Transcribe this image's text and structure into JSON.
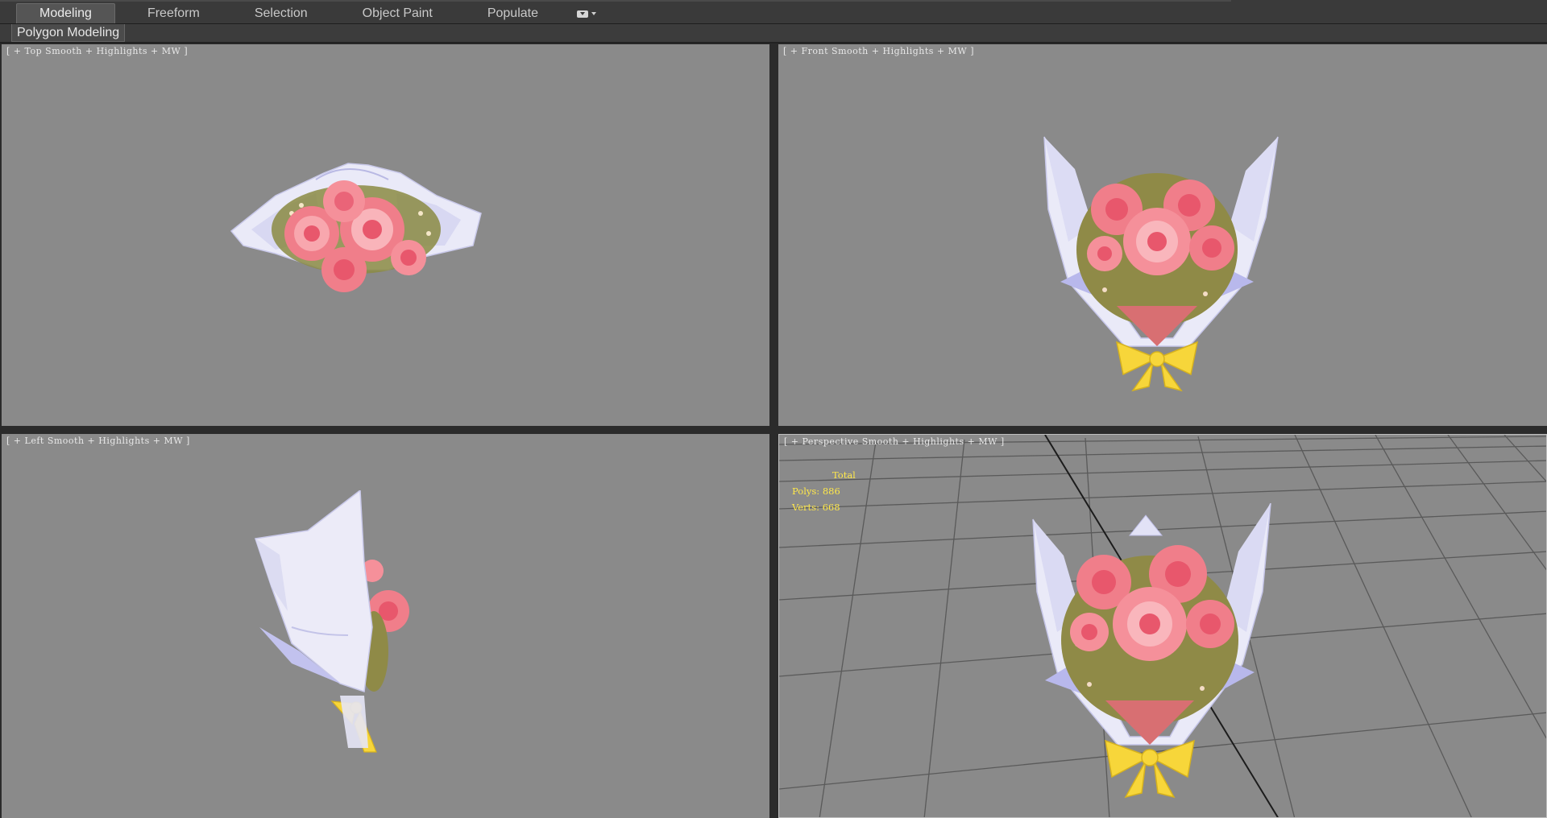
{
  "ribbon": {
    "tabs": [
      {
        "label": "Modeling",
        "active": true
      },
      {
        "label": "Freeform",
        "active": false
      },
      {
        "label": "Selection",
        "active": false
      },
      {
        "label": "Object Paint",
        "active": false
      },
      {
        "label": "Populate",
        "active": false
      }
    ],
    "menu_icon": "ribbon-options-icon",
    "panel_label": "Polygon Modeling"
  },
  "viewports": {
    "top": {
      "bracket_open": "[",
      "plus": "+",
      "name": "Top",
      "shading": "Smooth + Highlights + MW",
      "bracket_close": "]"
    },
    "front": {
      "bracket_open": "[",
      "plus": "+",
      "name": "Front",
      "shading": "Smooth + Highlights + MW",
      "bracket_close": "]"
    },
    "left": {
      "bracket_open": "[",
      "plus": "+",
      "name": "Left",
      "shading": "Smooth + Highlights + MW",
      "bracket_close": "]"
    },
    "perspective": {
      "bracket_open": "[",
      "plus": "+",
      "name": "Perspective",
      "shading": "Smooth + Highlights + MW",
      "bracket_close": "]"
    }
  },
  "stats": {
    "total_label": "Total",
    "polys_label": "Polys:",
    "polys_value": "886",
    "verts_label": "Verts:",
    "verts_value": "668"
  },
  "colors": {
    "viewport_bg": "#8a8a8a",
    "stats_text": "#ffe84a",
    "rose": "#f06d80",
    "wrapper": "#eeeefa",
    "ribbon": "#f7d63a"
  }
}
